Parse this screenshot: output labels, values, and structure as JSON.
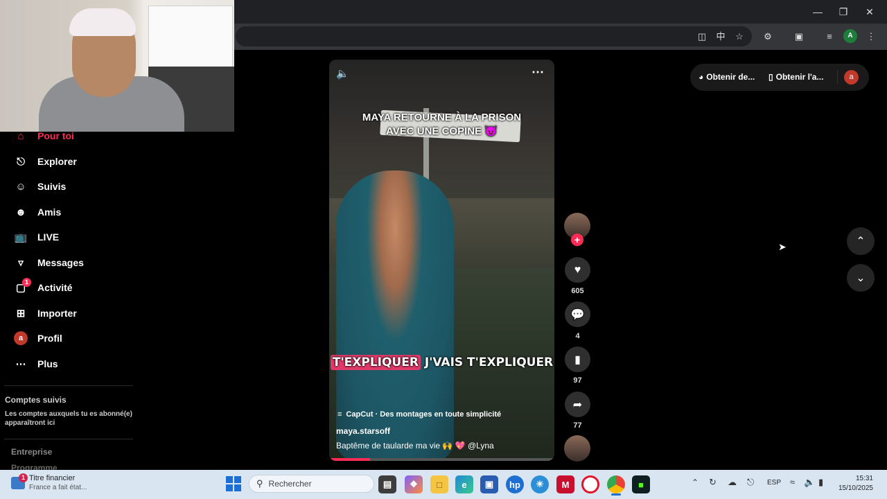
{
  "sidebar": {
    "items": [
      {
        "label": "Pour toi",
        "icon": "home-icon",
        "active": true
      },
      {
        "label": "Explorer",
        "icon": "compass-icon"
      },
      {
        "label": "Suivis",
        "icon": "user-follow-icon"
      },
      {
        "label": "Amis",
        "icon": "friends-icon"
      },
      {
        "label": "LIVE",
        "icon": "live-tv-icon"
      },
      {
        "label": "Messages",
        "icon": "send-icon"
      },
      {
        "label": "Activité",
        "icon": "activity-icon",
        "badge": "1"
      },
      {
        "label": "Importer",
        "icon": "plus-square-icon"
      },
      {
        "label": "Profil",
        "icon": "profile-avatar",
        "avatar_letter": "a"
      },
      {
        "label": "Plus",
        "icon": "more-icon"
      }
    ],
    "followed_title": "Comptes suivis",
    "followed_desc": "Les comptes auxquels tu es abonné(e) apparaîtront ici",
    "footer_links": [
      "Entreprise",
      "Programme"
    ]
  },
  "video": {
    "title_line1": "MAYA RETOURNE À LA PRISON",
    "title_line2": "AVEC UNE COPINE 😈",
    "subtitle_highlight": "T'EXPLIQUER",
    "subtitle_rest": "J'VAIS T'EXPLIQUER",
    "capcut_label": "CapCut · Des montages en toute simplicité",
    "username": "maya.starsoff",
    "description": "Baptême de taularde ma vie  🙌 💖 @Lyna",
    "progress": 0.18
  },
  "actions": {
    "likes": "605",
    "comments": "4",
    "saves": "97",
    "shares": "77"
  },
  "topbar": {
    "get_coins": "Obtenir de...",
    "get_app": "Obtenir l'a...",
    "user_letter": "a"
  },
  "taskbar": {
    "news_title": "Titre financier",
    "news_sub": "France a fait état...",
    "news_badge": "1",
    "search_placeholder": "Rechercher",
    "lang": "ESP",
    "time": "15:31",
    "date": "15/10/2025"
  },
  "colors": {
    "tiktok_red": "#fe2c55",
    "taskbar_bg": "#d9e6f2"
  }
}
